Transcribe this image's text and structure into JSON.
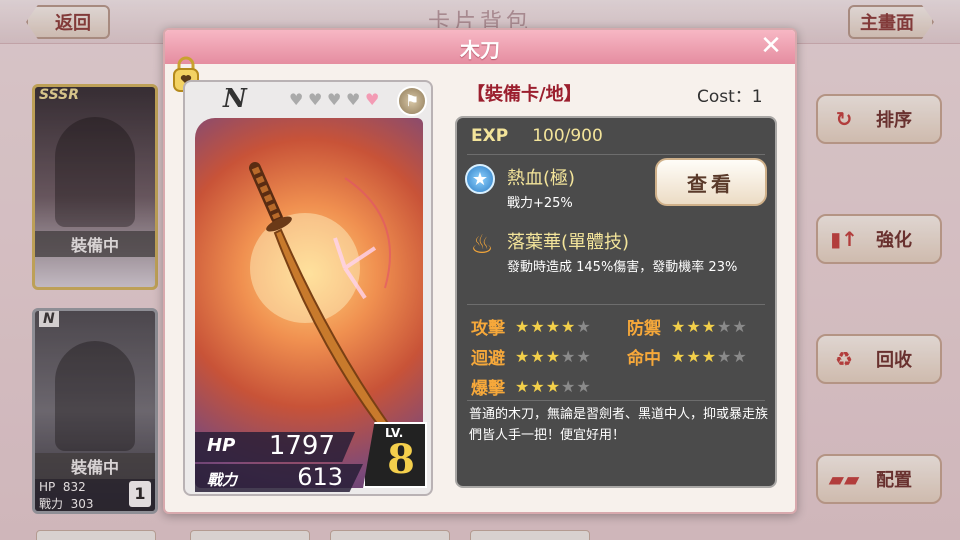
{
  "header": {
    "back_label": "返回",
    "title": "卡片背包",
    "home_label": "主畫面"
  },
  "left_cards": [
    {
      "rank": "SSSR",
      "status": "裝備中"
    },
    {
      "rank": "N",
      "status": "裝備中",
      "hp_label": "HP",
      "hp": "832",
      "power_label": "戰力",
      "power": "303",
      "lv": "1"
    }
  ],
  "side_buttons": [
    {
      "label": "排序",
      "icon": "refresh-icon"
    },
    {
      "label": "強化",
      "icon": "upgrade-icon"
    },
    {
      "label": "回收",
      "icon": "recycle-icon"
    },
    {
      "label": "配置",
      "icon": "cards-icon"
    }
  ],
  "dialog": {
    "title": "木刀",
    "close_symbol": "✕",
    "card": {
      "rank": "N",
      "hearts": 5,
      "hp_label": "HP",
      "hp": "1797",
      "power_label": "戰力",
      "power": "613",
      "lv_label": "LV.",
      "lv": "8"
    },
    "type_label": "【裝備卡/地】",
    "cost": "Cost：1",
    "exp_label": "EXP",
    "exp_value": "100/900",
    "view_label": "查看",
    "skill1": {
      "name": "熱血(極)",
      "desc": "戰力+25%"
    },
    "skill2": {
      "name": "落葉華(單體技)",
      "desc": "發動時造成 145%傷害，發動機率 23%"
    },
    "attributes": [
      {
        "name": "攻擊",
        "stars": 4,
        "max": 5
      },
      {
        "name": "防禦",
        "stars": 3,
        "max": 5
      },
      {
        "name": "迴避",
        "stars": 3,
        "max": 5
      },
      {
        "name": "命中",
        "stars": 3,
        "max": 5
      },
      {
        "name": "爆擊",
        "stars": 3,
        "max": 5
      }
    ],
    "description": "普通的木刀，無論是習劍者、黑道中人，抑或暴走族們皆人手一把！便宜好用！"
  },
  "colors": {
    "header_pink": "#e58da0",
    "panel_dark": "#4b4b4b",
    "attr_orange": "#f6a83a",
    "star_gold": "#f2cf4a"
  }
}
